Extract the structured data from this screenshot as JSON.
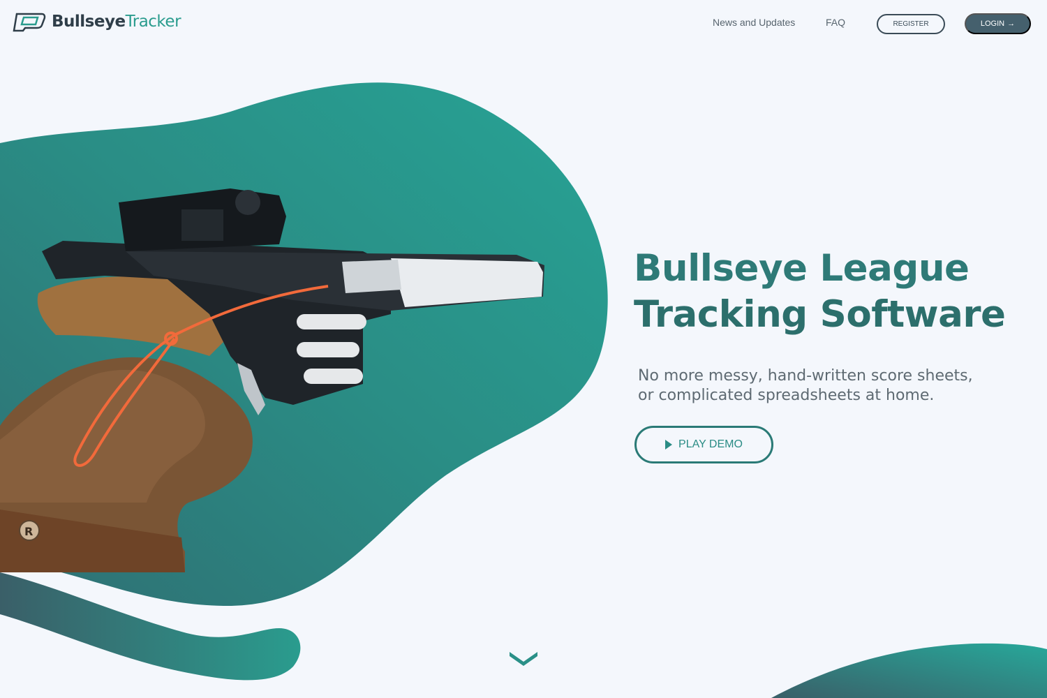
{
  "header": {
    "logo_bold": "Bullseye",
    "logo_light": "Tracker",
    "nav": {
      "news_label": "News and Updates",
      "faq_label": "FAQ"
    },
    "register_label": "REGISTER",
    "login_label": "LOGIN",
    "login_arrow": "→"
  },
  "hero": {
    "title_line1": "Bullseye League",
    "title_line2": "Tracking Software",
    "subtitle_line1": "No more messy, hand-written score sheets,",
    "subtitle_line2": "or complicated spreadsheets at home.",
    "demo_label": "PLAY DEMO"
  },
  "icons": {
    "logo": "bullseye-logo-icon",
    "play": "play-icon",
    "scroll": "chevron-down-icon"
  },
  "colors": {
    "accent": "#2a9c8e",
    "dark": "#3a4b57",
    "background": "#f4f7fc"
  }
}
